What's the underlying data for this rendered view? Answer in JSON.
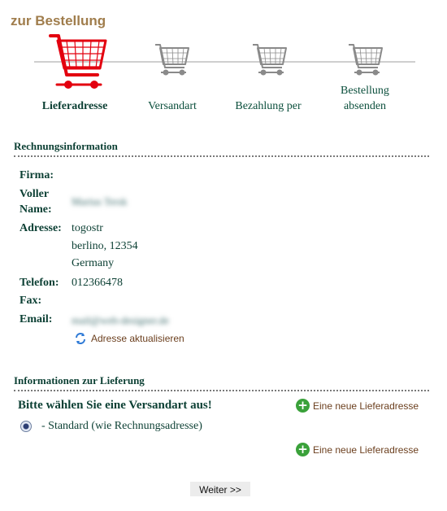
{
  "page": {
    "title": "zur Bestellung"
  },
  "steps": [
    {
      "label": "Lieferadresse",
      "active": true
    },
    {
      "label": "Versandart",
      "active": false
    },
    {
      "label": "Bezahlung per",
      "active": false
    },
    {
      "label_line1": "Bestellung",
      "label_line2": "absenden",
      "active": false
    }
  ],
  "billing": {
    "header": "Rechnungsinformation",
    "labels": {
      "company": "Firma:",
      "name_line1": "Voller",
      "name_line2": "Name:",
      "address": "Adresse:",
      "phone": "Telefon:",
      "fax": "Fax:",
      "email": "Email:"
    },
    "values": {
      "company": "",
      "name": "Marius Tersk",
      "address_line1": "togostr",
      "address_line2": "berlino, 12354",
      "address_line3": "Germany",
      "phone": "012366478",
      "fax": "",
      "email": "mail@web-designer.de"
    },
    "update_link": "Adresse aktualisieren"
  },
  "delivery": {
    "header": "Informationen zur Lieferung",
    "prompt": "Bitte wählen Sie eine Versandart aus!",
    "new_address_link": "Eine neue Lieferadresse",
    "option": {
      "label": "- Standard (wie Rechnungsadresse)",
      "selected": true
    }
  },
  "actions": {
    "next": "Weiter >>"
  },
  "colors": {
    "active_cart": "#e3000f",
    "inactive_cart": "#8a8a8a",
    "title": "#a07d4c",
    "text": "#0b3f33"
  },
  "icons": {
    "cart": "shopping-cart-icon",
    "refresh": "refresh-icon",
    "add": "plus-icon"
  }
}
